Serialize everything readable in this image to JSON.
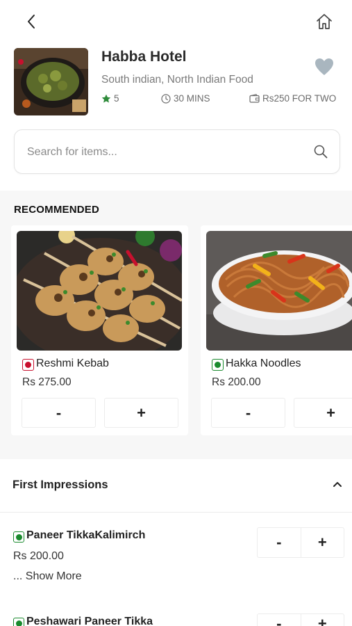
{
  "hotel": {
    "name": "Habba Hotel",
    "cuisine": "South indian, North Indian Food",
    "rating": "5",
    "time": "30 MINS",
    "cost": "Rs250 FOR TWO"
  },
  "search": {
    "placeholder": "Search for items..."
  },
  "recommended": {
    "title": "RECOMMENDED",
    "items": [
      {
        "name": "Reshmi Kebab",
        "price": "Rs 275.00",
        "type": "non-veg",
        "minus": "-",
        "plus": "+"
      },
      {
        "name": "Hakka Noodles",
        "price": "Rs 200.00",
        "type": "veg",
        "minus": "-",
        "plus": "+"
      }
    ]
  },
  "category": {
    "title": "First Impressions",
    "items": [
      {
        "name": "Paneer TikkaKalimirch",
        "price": "Rs 200.00",
        "show_more": "... Show More",
        "type": "veg",
        "minus": "-",
        "plus": "+"
      },
      {
        "name": "Peshawari Paneer Tikka",
        "type": "veg",
        "minus": "-",
        "plus": "+"
      }
    ]
  },
  "colors": {
    "veg": "#1a8a2e",
    "non_veg": "#c8102e",
    "favorite": "#a9b6bf",
    "star": "#2e8b3a"
  },
  "icons": [
    "back-arrow-icon",
    "home-icon",
    "heart-icon",
    "star-icon",
    "clock-icon",
    "wallet-icon",
    "search-icon",
    "chevron-up-icon"
  ]
}
